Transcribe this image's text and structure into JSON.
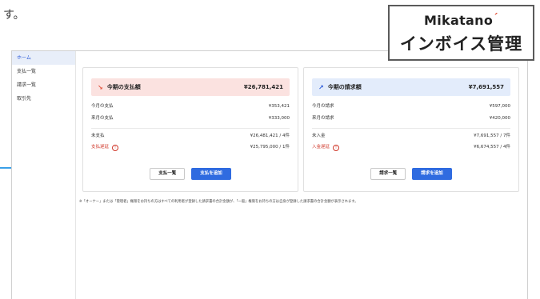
{
  "top_fragment": "す。",
  "brand": {
    "name": "Mikatano",
    "accent_mark": "´",
    "product": "インボイス管理"
  },
  "sidebar": {
    "items": [
      {
        "label": "ホーム",
        "active": true
      },
      {
        "label": "支払一覧",
        "active": false
      },
      {
        "label": "請求一覧",
        "active": false
      },
      {
        "label": "取引先",
        "active": false
      }
    ]
  },
  "payments": {
    "arrow": "↘",
    "title": "今期の支払額",
    "amount": "¥26,781,421",
    "rows": [
      {
        "label": "今月の支払",
        "value": "¥353,421"
      },
      {
        "label": "来月の支払",
        "value": "¥333,000"
      },
      {
        "label": "未支払",
        "value": "¥26,481,421 / 4件"
      },
      {
        "label": "支払遅延",
        "value": "¥25,795,000 / 1件"
      }
    ],
    "list_button": "支払一覧",
    "add_button": "支払を追加"
  },
  "invoices": {
    "arrow": "↗",
    "title": "今期の請求額",
    "amount": "¥7,691,557",
    "rows": [
      {
        "label": "今月の請求",
        "value": "¥597,000"
      },
      {
        "label": "来月の請求",
        "value": "¥420,000"
      },
      {
        "label": "未入金",
        "value": "¥7,691,557 / 7件"
      },
      {
        "label": "入金遅延",
        "value": "¥6,674,557 / 4件"
      }
    ],
    "list_button": "請求一覧",
    "add_button": "請求を追加"
  },
  "footnote": "※「オーナー」または「管理者」権限をお持ちの方はすべての利用者が登録した請求書の合計金額が、「一般」権限をお持ちの方は自身が登録した請求書の合計金額が表示されます。",
  "colors": {
    "accent_blue": "#2f6be0",
    "warn_red": "#d0392b",
    "pay_header_bg": "#fbe2e0",
    "invoice_header_bg": "#e3ecfb"
  }
}
